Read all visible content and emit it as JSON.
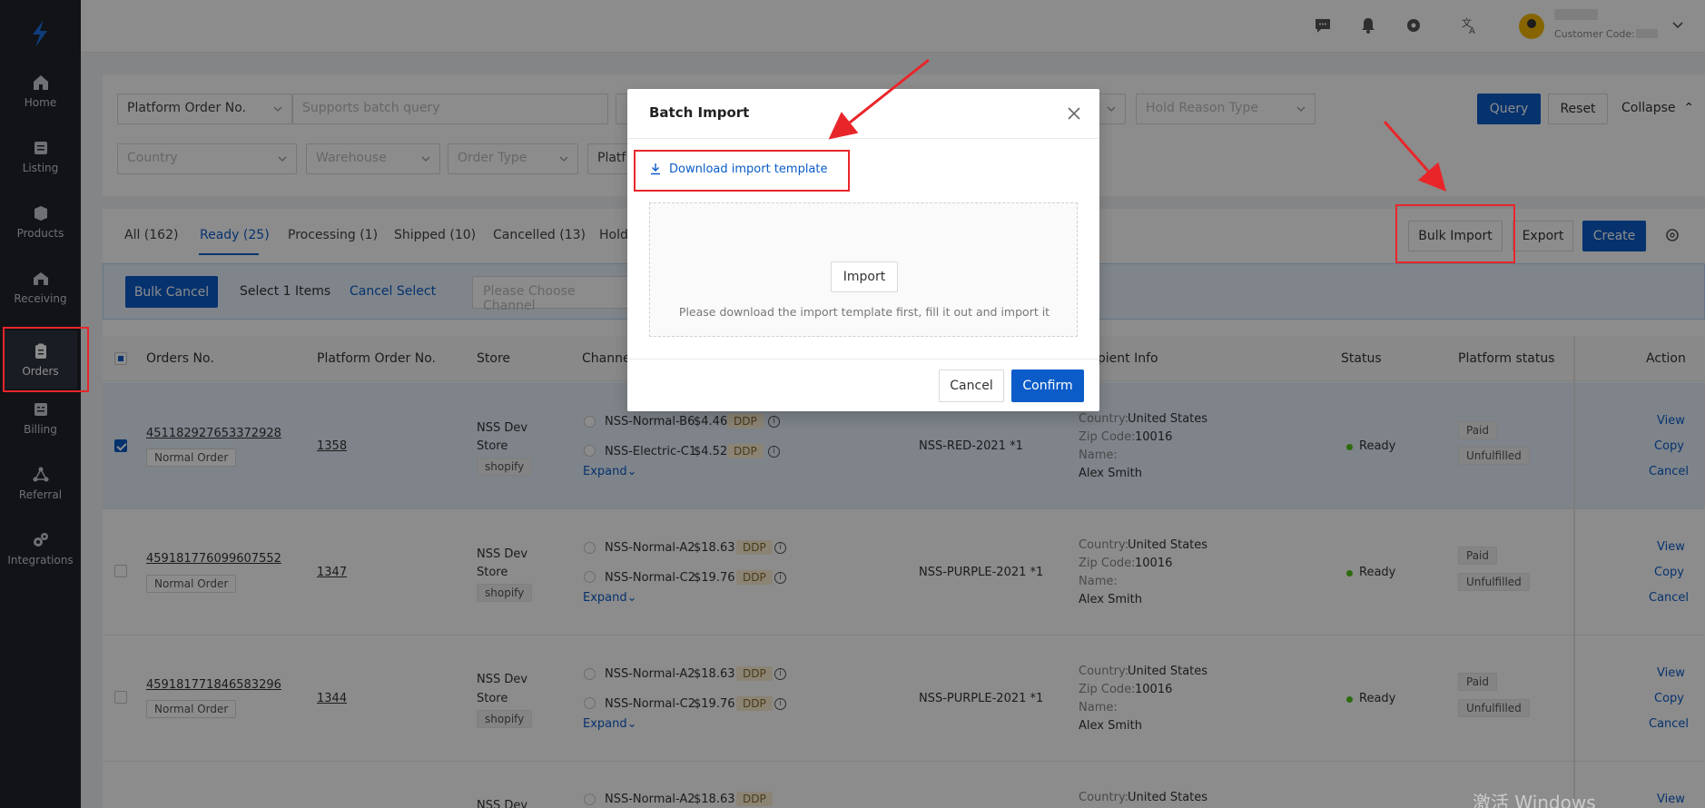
{
  "sidebar": {
    "items": [
      {
        "label": "Home",
        "icon": "home-icon"
      },
      {
        "label": "Listing",
        "icon": "listing-icon"
      },
      {
        "label": "Products",
        "icon": "products-icon"
      },
      {
        "label": "Receiving",
        "icon": "receiving-icon"
      },
      {
        "label": "Orders",
        "icon": "orders-icon",
        "active": true
      },
      {
        "label": "Billing",
        "icon": "billing-icon"
      },
      {
        "label": "Referral",
        "icon": "referral-icon"
      },
      {
        "label": "Integrations",
        "icon": "integrations-icon"
      }
    ]
  },
  "header": {
    "customer_code_label": "Customer Code:"
  },
  "filters": {
    "field1_label": "Platform Order No.",
    "field1_placeholder": "Supports batch query",
    "hold_reason": "Hold Reason Type",
    "country": "Country",
    "warehouse": "Warehouse",
    "order_type": "Order Type",
    "platform": "Platf",
    "query": "Query",
    "reset": "Reset",
    "collapse": "Collapse"
  },
  "tabs": [
    "All (162)",
    "Ready (25)",
    "Processing (1)",
    "Shipped (10)",
    "Cancelled (13)",
    "Hold"
  ],
  "toolbar": {
    "bulk_import": "Bulk Import",
    "export": "Export",
    "create": "Create"
  },
  "bulk_bar": {
    "bulk_cancel": "Bulk Cancel",
    "selected": "Select 1 Items",
    "cancel_select": "Cancel Select",
    "channel_placeholder": "Please Choose Channel"
  },
  "table": {
    "headers": {
      "orders_no": "Orders No.",
      "platform_order_no": "Platform Order No.",
      "store": "Store",
      "channel": "Channel",
      "recipient": "ipient Info",
      "status": "Status",
      "platform_status": "Platform status",
      "action": "Action"
    },
    "rows": [
      {
        "order_no": "451182927653372928",
        "order_type": "Normal Order",
        "platform_no": "1358",
        "store1": "NSS Dev",
        "store2": "Store",
        "store_platform": "shopify",
        "ch1": "NSS-Normal-B6",
        "ch1_price": "$4.46",
        "ch2": "NSS-Electric-C1",
        "ch2_price": "$4.52",
        "ddp": "DDP",
        "expand": "Expand",
        "sku": "NSS-RED-2021 *1",
        "country_label": "Country:",
        "country": "United States",
        "zip_label": "Zip Code:",
        "zip": "10016",
        "name_label": "Name:",
        "name": "Alex Smith",
        "status": "Ready",
        "pay": "Paid",
        "fulfill": "Unfulfilled",
        "view": "View",
        "copy": "Copy",
        "cancel": "Cancel"
      },
      {
        "order_no": "459181776099607552",
        "order_type": "Normal Order",
        "platform_no": "1347",
        "store1": "NSS Dev",
        "store2": "Store",
        "store_platform": "shopify",
        "ch1": "NSS-Normal-A2",
        "ch1_price": "$18.63",
        "ch2": "NSS-Normal-C2",
        "ch2_price": "$19.76",
        "ddp": "DDP",
        "expand": "Expand",
        "sku": "NSS-PURPLE-2021 *1",
        "country_label": "Country:",
        "country": "United States",
        "zip_label": "Zip Code:",
        "zip": "10016",
        "name_label": "Name:",
        "name": "Alex Smith",
        "status": "Ready",
        "pay": "Paid",
        "fulfill": "Unfulfilled",
        "view": "View",
        "copy": "Copy",
        "cancel": "Cancel"
      },
      {
        "order_no": "459181771846583296",
        "order_type": "Normal Order",
        "platform_no": "1344",
        "store1": "NSS Dev",
        "store2": "Store",
        "store_platform": "shopify",
        "ch1": "NSS-Normal-A2",
        "ch1_price": "$18.63",
        "ch2": "NSS-Normal-C2",
        "ch2_price": "$19.76",
        "ddp": "DDP",
        "expand": "Expand",
        "sku": "NSS-PURPLE-2021 *1",
        "country_label": "Country:",
        "country": "United States",
        "zip_label": "Zip Code:",
        "zip": "10016",
        "name_label": "Name:",
        "name": "Alex Smith",
        "status": "Ready",
        "pay": "Paid",
        "fulfill": "Unfulfilled",
        "view": "View",
        "copy": "Copy",
        "cancel": "Cancel"
      },
      {
        "store1": "NSS Dev",
        "ch1": "NSS-Normal-A2",
        "ch1_price": "$18.63",
        "ddp": "DDP",
        "country_label": "Country:",
        "country": "United States",
        "view": "View"
      }
    ]
  },
  "modal": {
    "title": "Batch Import",
    "download_link": "Download import template",
    "import_button": "Import",
    "hint": "Please download the import template first, fill it out and import it",
    "cancel": "Cancel",
    "confirm": "Confirm"
  },
  "watermark": "激活 Windows",
  "colors": {
    "primary": "#0b5cc8",
    "highlight": "#e8262a",
    "sidebar": "#1f2329",
    "ready_dot": "#52c41a"
  }
}
